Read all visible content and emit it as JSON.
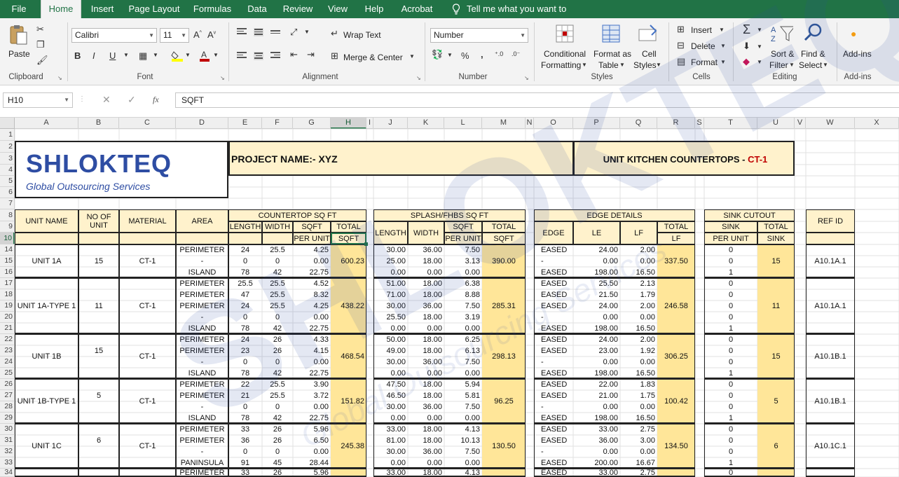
{
  "menu": {
    "tabs": [
      "File",
      "Home",
      "Insert",
      "Page Layout",
      "Formulas",
      "Data",
      "Review",
      "View",
      "Help",
      "Acrobat"
    ],
    "active": "Home",
    "tellme": "Tell me what you want to do"
  },
  "ribbon": {
    "clipboard": {
      "label": "Clipboard",
      "paste": "Paste"
    },
    "font": {
      "label": "Font",
      "name": "Calibri",
      "size": "11",
      "bold": "B",
      "italic": "I",
      "underline": "U"
    },
    "alignment": {
      "label": "Alignment",
      "wrap": "Wrap Text",
      "merge": "Merge & Center"
    },
    "number": {
      "label": "Number",
      "format": "Number",
      "percent": "%",
      "comma": ","
    },
    "styles": {
      "label": "Styles",
      "conditional1": "Conditional",
      "conditional2": "Formatting",
      "table1": "Format as",
      "table2": "Table",
      "cell1": "Cell",
      "cell2": "Styles"
    },
    "cells": {
      "label": "Cells",
      "insert": "Insert",
      "delete": "Delete",
      "format": "Format"
    },
    "editing": {
      "label": "Editing",
      "sort1": "Sort &",
      "sort2": "Filter",
      "find1": "Find &",
      "find2": "Select"
    },
    "addins": {
      "label": "Add-ins",
      "btn": "Add-ins"
    }
  },
  "formula_bar": {
    "name_box": "H10",
    "fx": "fx",
    "content": "SQFT"
  },
  "columns": [
    "A",
    "B",
    "C",
    "D",
    "E",
    "F",
    "G",
    "H",
    "I",
    "J",
    "K",
    "L",
    "M",
    "N",
    "O",
    "P",
    "Q",
    "R",
    "S",
    "T",
    "U",
    "V",
    "W",
    "X"
  ],
  "rows": [
    "1",
    "2",
    "3",
    "4",
    "5",
    "6",
    "7",
    "8",
    "9",
    "10",
    "14",
    "15",
    "16",
    "17",
    "18",
    "19",
    "20",
    "21",
    "22",
    "23",
    "24",
    "25",
    "26",
    "27",
    "28",
    "29",
    "30",
    "31",
    "32",
    "33",
    "34"
  ],
  "header": {
    "logo_main": "SHLOKTEQ",
    "logo_sub": "Global Outsourcing Services",
    "project": "PROJECT NAME:- XYZ",
    "unit_title": "UNIT KITCHEN COUNTERTOPS - ",
    "unit_code": "CT-1",
    "unit_code_color": "#c00000"
  },
  "table_headers": {
    "unit_name": "UNIT NAME",
    "no_of_unit": "NO OF UNIT",
    "material": "MATERIAL",
    "area": "AREA",
    "countertop": "COUNTERTOP SQ FT",
    "length": "LENGTH",
    "width": "WIDTH",
    "sqft": "SQFT",
    "per_unit": "PER UNIT",
    "total": "TOTAL",
    "total_sqft": "SQFT",
    "splash": "SPLASH/FHBS SQ FT",
    "edge_details": "EDGE DETAILS",
    "edge": "EDGE",
    "le": "LE",
    "lf": "LF",
    "total_lf": "LF",
    "sink_cutout": "SINK CUTOUT",
    "sink": "SINK",
    "total_sink": "SINK",
    "ref_id": "REF ID"
  },
  "groups": [
    {
      "unit": "UNIT 1A",
      "count": "15",
      "material": "CT-1",
      "ct_total": "600.23",
      "sp_total": "390.00",
      "lf_total": "337.50",
      "sink_total": "15",
      "ref": "A10.1A.1",
      "lines": [
        [
          "PERIMETER",
          "24",
          "25.5",
          "4.25",
          "30.00",
          "36.00",
          "7.50",
          "EASED",
          "24.00",
          "2.00",
          "0"
        ],
        [
          "-",
          "0",
          "0",
          "0.00",
          "25.00",
          "18.00",
          "3.13",
          "-",
          "0.00",
          "0.00",
          "0"
        ],
        [
          "ISLAND",
          "78",
          "42",
          "22.75",
          "0.00",
          "0.00",
          "0.00",
          "EASED",
          "198.00",
          "16.50",
          "1"
        ]
      ]
    },
    {
      "unit": "UNIT 1A-TYPE 1",
      "count": "11",
      "material": "CT-1",
      "ct_total": "438.22",
      "sp_total": "285.31",
      "lf_total": "246.58",
      "sink_total": "11",
      "ref": "A10.1A.1",
      "lines": [
        [
          "PERIMETER",
          "25.5",
          "25.5",
          "4.52",
          "51.00",
          "18.00",
          "6.38",
          "EASED",
          "25.50",
          "2.13",
          "0"
        ],
        [
          "PERIMETER",
          "47",
          "25.5",
          "8.32",
          "71.00",
          "18.00",
          "8.88",
          "EASED",
          "21.50",
          "1.79",
          "0"
        ],
        [
          "PERIMETER",
          "24",
          "25.5",
          "4.25",
          "30.00",
          "36.00",
          "7.50",
          "EASED",
          "24.00",
          "2.00",
          "0"
        ],
        [
          "-",
          "0",
          "0",
          "0.00",
          "25.50",
          "18.00",
          "3.19",
          "-",
          "0.00",
          "0.00",
          "0"
        ],
        [
          "ISLAND",
          "78",
          "42",
          "22.75",
          "0.00",
          "0.00",
          "0.00",
          "EASED",
          "198.00",
          "16.50",
          "1"
        ]
      ]
    },
    {
      "unit": "UNIT 1B",
      "count": "15",
      "material": "CT-1",
      "ct_total": "468.54",
      "sp_total": "298.13",
      "lf_total": "306.25",
      "sink_total": "15",
      "ref": "A10.1B.1",
      "lines": [
        [
          "PERIMETER",
          "24",
          "26",
          "4.33",
          "50.00",
          "18.00",
          "6.25",
          "EASED",
          "24.00",
          "2.00",
          "0"
        ],
        [
          "PERIMETER",
          "23",
          "26",
          "4.15",
          "49.00",
          "18.00",
          "6.13",
          "EASED",
          "23.00",
          "1.92",
          "0"
        ],
        [
          "-",
          "0",
          "0",
          "0.00",
          "30.00",
          "36.00",
          "7.50",
          "-",
          "0.00",
          "0.00",
          "0"
        ],
        [
          "ISLAND",
          "78",
          "42",
          "22.75",
          "0.00",
          "0.00",
          "0.00",
          "EASED",
          "198.00",
          "16.50",
          "1"
        ]
      ]
    },
    {
      "unit": "UNIT 1B-TYPE 1",
      "count": "5",
      "material": "CT-1",
      "ct_total": "151.82",
      "sp_total": "96.25",
      "lf_total": "100.42",
      "sink_total": "5",
      "ref": "A10.1B.1",
      "lines": [
        [
          "PERIMETER",
          "22",
          "25.5",
          "3.90",
          "47.50",
          "18.00",
          "5.94",
          "EASED",
          "22.00",
          "1.83",
          "0"
        ],
        [
          "PERIMETER",
          "21",
          "25.5",
          "3.72",
          "46.50",
          "18.00",
          "5.81",
          "EASED",
          "21.00",
          "1.75",
          "0"
        ],
        [
          "-",
          "0",
          "0",
          "0.00",
          "30.00",
          "36.00",
          "7.50",
          "-",
          "0.00",
          "0.00",
          "0"
        ],
        [
          "ISLAND",
          "78",
          "42",
          "22.75",
          "0.00",
          "0.00",
          "0.00",
          "EASED",
          "198.00",
          "16.50",
          "1"
        ]
      ]
    },
    {
      "unit": "UNIT 1C",
      "count": "6",
      "material": "CT-1",
      "ct_total": "245.38",
      "sp_total": "130.50",
      "lf_total": "134.50",
      "sink_total": "6",
      "ref": "A10.1C.1",
      "lines": [
        [
          "PERIMETER",
          "33",
          "26",
          "5.96",
          "33.00",
          "18.00",
          "4.13",
          "EASED",
          "33.00",
          "2.75",
          "0"
        ],
        [
          "PERIMETER",
          "36",
          "26",
          "6.50",
          "81.00",
          "18.00",
          "10.13",
          "EASED",
          "36.00",
          "3.00",
          "0"
        ],
        [
          "-",
          "0",
          "0",
          "0.00",
          "30.00",
          "36.00",
          "7.50",
          "-",
          "0.00",
          "0.00",
          "0"
        ],
        [
          "PANINSULA",
          "91",
          "45",
          "28.44",
          "0.00",
          "0.00",
          "0.00",
          "EASED",
          "200.00",
          "16.67",
          "1"
        ]
      ]
    },
    {
      "unit": "",
      "count": "",
      "material": "",
      "ct_total": "",
      "sp_total": "",
      "lf_total": "",
      "sink_total": "",
      "ref": "",
      "lines": [
        [
          "PERIMETER",
          "33",
          "26",
          "5.96",
          "33.00",
          "18.00",
          "4.13",
          "EASED",
          "33.00",
          "2.75",
          "0"
        ]
      ]
    }
  ],
  "watermark": {
    "big": "SHLOKTEQ",
    "small": "Global Outsourcing Services"
  }
}
